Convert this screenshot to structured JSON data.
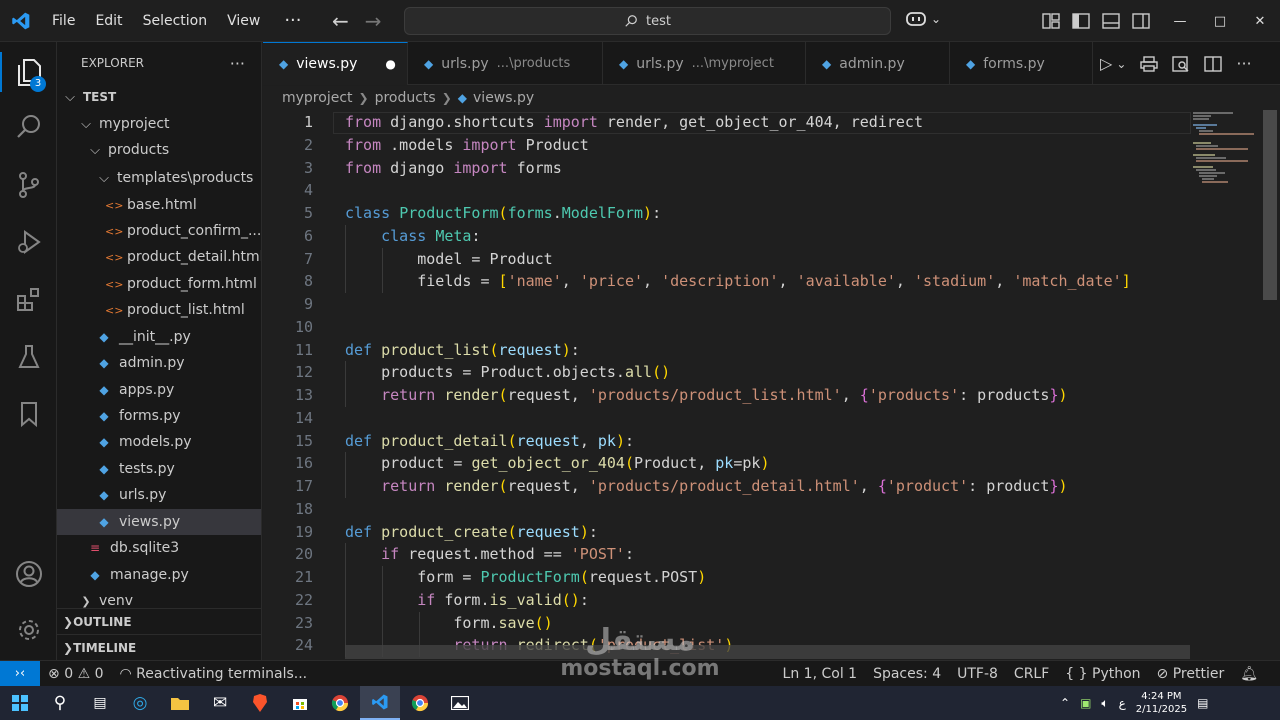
{
  "titlebar": {
    "menu": [
      "File",
      "Edit",
      "Selection",
      "View"
    ],
    "more": "···",
    "search_text": "test"
  },
  "activity": {
    "explorer_badge": "3"
  },
  "sidebar": {
    "title": "EXPLORER",
    "more": "···",
    "tree": [
      {
        "label": "TEST",
        "depth": 0,
        "kind": "folder-root",
        "open": true
      },
      {
        "label": "myproject",
        "depth": 1,
        "kind": "folder",
        "open": true
      },
      {
        "label": "products",
        "depth": 2,
        "kind": "folder",
        "open": true
      },
      {
        "label": "templates\\products",
        "depth": 3,
        "kind": "folder",
        "open": true
      },
      {
        "label": "base.html",
        "depth": 4,
        "kind": "html"
      },
      {
        "label": "product_confirm_...",
        "depth": 4,
        "kind": "html"
      },
      {
        "label": "product_detail.html",
        "depth": 4,
        "kind": "html"
      },
      {
        "label": "product_form.html",
        "depth": 4,
        "kind": "html"
      },
      {
        "label": "product_list.html",
        "depth": 4,
        "kind": "html"
      },
      {
        "label": "__init__.py",
        "depth": 3,
        "kind": "py"
      },
      {
        "label": "admin.py",
        "depth": 3,
        "kind": "py"
      },
      {
        "label": "apps.py",
        "depth": 3,
        "kind": "py"
      },
      {
        "label": "forms.py",
        "depth": 3,
        "kind": "py"
      },
      {
        "label": "models.py",
        "depth": 3,
        "kind": "py"
      },
      {
        "label": "tests.py",
        "depth": 3,
        "kind": "py"
      },
      {
        "label": "urls.py",
        "depth": 3,
        "kind": "py"
      },
      {
        "label": "views.py",
        "depth": 3,
        "kind": "py",
        "selected": true
      },
      {
        "label": "db.sqlite3",
        "depth": 2,
        "kind": "db"
      },
      {
        "label": "manage.py",
        "depth": 2,
        "kind": "py"
      },
      {
        "label": "venv",
        "depth": 1,
        "kind": "folder",
        "open": false
      }
    ],
    "outline": "OUTLINE",
    "timeline": "TIMELINE"
  },
  "tabs": [
    {
      "name": "views.py",
      "desc": "",
      "active": true,
      "dirty": "●"
    },
    {
      "name": "urls.py",
      "desc": "...\\products",
      "active": false
    },
    {
      "name": "urls.py",
      "desc": "...\\myproject",
      "active": false
    },
    {
      "name": "admin.py",
      "desc": "",
      "active": false
    },
    {
      "name": "forms.py",
      "desc": "",
      "active": false
    }
  ],
  "breadcrumb": [
    "myproject",
    "products",
    "views.py"
  ],
  "code": [
    [
      [
        "kw2",
        "from"
      ],
      [
        "txt",
        " django.shortcuts "
      ],
      [
        "kw2",
        "import"
      ],
      [
        "txt",
        " render, get_object_or_404, redirect"
      ]
    ],
    [
      [
        "kw2",
        "from"
      ],
      [
        "txt",
        " .models "
      ],
      [
        "kw2",
        "import"
      ],
      [
        "txt",
        " Product"
      ]
    ],
    [
      [
        "kw2",
        "from"
      ],
      [
        "txt",
        " django "
      ],
      [
        "kw2",
        "import"
      ],
      [
        "txt",
        " forms"
      ]
    ],
    [],
    [
      [
        "kw",
        "class"
      ],
      [
        "txt",
        " "
      ],
      [
        "cls",
        "ProductForm"
      ],
      [
        "br1",
        "("
      ],
      [
        "cls",
        "forms"
      ],
      [
        "txt",
        "."
      ],
      [
        "cls",
        "ModelForm"
      ],
      [
        "br1",
        ")"
      ],
      [
        "txt",
        ":"
      ]
    ],
    [
      [
        "txt",
        "    "
      ],
      [
        "kw",
        "class"
      ],
      [
        "txt",
        " "
      ],
      [
        "cls",
        "Meta"
      ],
      [
        "txt",
        ":"
      ]
    ],
    [
      [
        "txt",
        "        model = Product"
      ]
    ],
    [
      [
        "txt",
        "        fields = "
      ],
      [
        "br1",
        "["
      ],
      [
        "str",
        "'name'"
      ],
      [
        "txt",
        ", "
      ],
      [
        "str",
        "'price'"
      ],
      [
        "txt",
        ", "
      ],
      [
        "str",
        "'description'"
      ],
      [
        "txt",
        ", "
      ],
      [
        "str",
        "'available'"
      ],
      [
        "txt",
        ", "
      ],
      [
        "str",
        "'stadium'"
      ],
      [
        "txt",
        ", "
      ],
      [
        "str",
        "'match_date'"
      ],
      [
        "br1",
        "]"
      ]
    ],
    [],
    [],
    [
      [
        "kw",
        "def"
      ],
      [
        "txt",
        " "
      ],
      [
        "fn",
        "product_list"
      ],
      [
        "br1",
        "("
      ],
      [
        "par",
        "request"
      ],
      [
        "br1",
        ")"
      ],
      [
        "txt",
        ":"
      ]
    ],
    [
      [
        "txt",
        "    products = Product.objects."
      ],
      [
        "fn",
        "all"
      ],
      [
        "br1",
        "()"
      ]
    ],
    [
      [
        "txt",
        "    "
      ],
      [
        "kw2",
        "return"
      ],
      [
        "txt",
        " "
      ],
      [
        "fn",
        "render"
      ],
      [
        "br1",
        "("
      ],
      [
        "txt",
        "request, "
      ],
      [
        "str",
        "'products/product_list.html'"
      ],
      [
        "txt",
        ", "
      ],
      [
        "br2",
        "{"
      ],
      [
        "str",
        "'products'"
      ],
      [
        "txt",
        ": products"
      ],
      [
        "br2",
        "}"
      ],
      [
        "br1",
        ")"
      ]
    ],
    [],
    [
      [
        "kw",
        "def"
      ],
      [
        "txt",
        " "
      ],
      [
        "fn",
        "product_detail"
      ],
      [
        "br1",
        "("
      ],
      [
        "par",
        "request"
      ],
      [
        "txt",
        ", "
      ],
      [
        "par",
        "pk"
      ],
      [
        "br1",
        ")"
      ],
      [
        "txt",
        ":"
      ]
    ],
    [
      [
        "txt",
        "    product = "
      ],
      [
        "fn",
        "get_object_or_404"
      ],
      [
        "br1",
        "("
      ],
      [
        "txt",
        "Product, "
      ],
      [
        "par",
        "pk"
      ],
      [
        "txt",
        "=pk"
      ],
      [
        "br1",
        ")"
      ]
    ],
    [
      [
        "txt",
        "    "
      ],
      [
        "kw2",
        "return"
      ],
      [
        "txt",
        " "
      ],
      [
        "fn",
        "render"
      ],
      [
        "br1",
        "("
      ],
      [
        "txt",
        "request, "
      ],
      [
        "str",
        "'products/product_detail.html'"
      ],
      [
        "txt",
        ", "
      ],
      [
        "br2",
        "{"
      ],
      [
        "str",
        "'product'"
      ],
      [
        "txt",
        ": product"
      ],
      [
        "br2",
        "}"
      ],
      [
        "br1",
        ")"
      ]
    ],
    [],
    [
      [
        "kw",
        "def"
      ],
      [
        "txt",
        " "
      ],
      [
        "fn",
        "product_create"
      ],
      [
        "br1",
        "("
      ],
      [
        "par",
        "request"
      ],
      [
        "br1",
        ")"
      ],
      [
        "txt",
        ":"
      ]
    ],
    [
      [
        "txt",
        "    "
      ],
      [
        "kw2",
        "if"
      ],
      [
        "txt",
        " request.method == "
      ],
      [
        "str",
        "'POST'"
      ],
      [
        "txt",
        ":"
      ]
    ],
    [
      [
        "txt",
        "        form = "
      ],
      [
        "cls",
        "ProductForm"
      ],
      [
        "br1",
        "("
      ],
      [
        "txt",
        "request.POST"
      ],
      [
        "br1",
        ")"
      ]
    ],
    [
      [
        "txt",
        "        "
      ],
      [
        "kw2",
        "if"
      ],
      [
        "txt",
        " form."
      ],
      [
        "fn",
        "is_valid"
      ],
      [
        "br1",
        "()"
      ],
      [
        "txt",
        ":"
      ]
    ],
    [
      [
        "txt",
        "            form."
      ],
      [
        "fn",
        "save"
      ],
      [
        "br1",
        "()"
      ]
    ],
    [
      [
        "txt",
        "            "
      ],
      [
        "kw2",
        "return"
      ],
      [
        "txt",
        " "
      ],
      [
        "fn",
        "redirect"
      ],
      [
        "br1",
        "("
      ],
      [
        "str",
        "'product_list'"
      ],
      [
        "br1",
        ")"
      ]
    ]
  ],
  "status": {
    "errors": "0",
    "warnings": "0",
    "activity": "Reactivating terminals...",
    "position": "Ln 1, Col 1",
    "spaces": "Spaces: 4",
    "encoding": "UTF-8",
    "eol": "CRLF",
    "language_braces": "{ }",
    "language": "Python",
    "formatter": "Prettier"
  },
  "taskbar": {
    "time": "4:24 PM",
    "date": "2/11/2025",
    "lang": "ع"
  },
  "watermark": {
    "arabic": "مستقل",
    "latin": "mostaql.com"
  }
}
